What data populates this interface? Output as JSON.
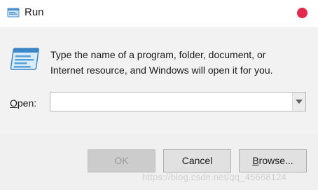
{
  "window": {
    "title": "Run"
  },
  "content": {
    "description_line1": "Type the name of a program, folder, document, or",
    "description_line2": "Internet resource, and Windows will open it for you.",
    "open_label_mnemonic": "O",
    "open_label_rest": "pen:",
    "open_value": ""
  },
  "buttons": {
    "ok_label": "OK",
    "cancel_label": "Cancel",
    "browse_mnemonic": "B",
    "browse_rest": "rowse..."
  },
  "watermark": "https://blog.csdn.net/qq_45668124",
  "colors": {
    "close_dot": "#e3284e",
    "content_bg": "#f2f2f2",
    "footer_bg": "#f0f0f0",
    "button_bg": "#e1e1e1",
    "button_disabled_bg": "#cccccc"
  },
  "icons": {
    "title": "run-icon",
    "main": "run-window-icon",
    "dropdown": "chevron-down-icon"
  }
}
